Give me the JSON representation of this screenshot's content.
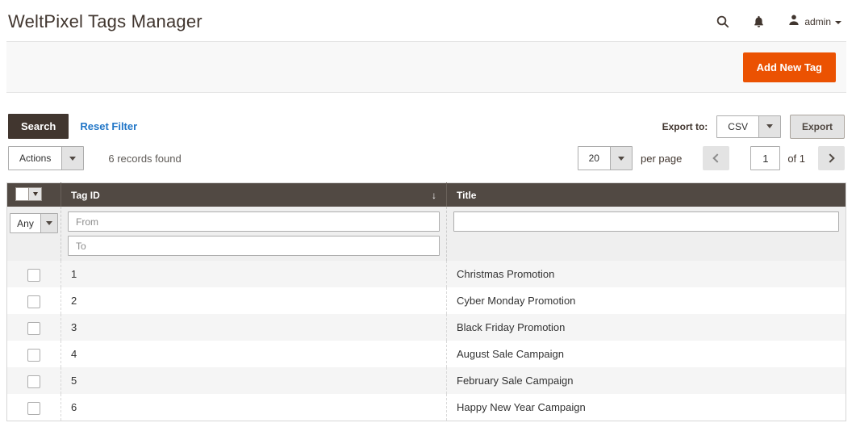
{
  "page": {
    "title": "WeltPixel Tags Manager"
  },
  "header": {
    "username": "admin"
  },
  "toolbar": {
    "add_new_tag": "Add New Tag"
  },
  "filter_bar": {
    "search": "Search",
    "reset_filter": "Reset Filter",
    "export_to_label": "Export to:",
    "export_format": "CSV",
    "export": "Export"
  },
  "grid_controls": {
    "actions": "Actions",
    "records_found": "6 records found",
    "per_page_value": "20",
    "per_page_label": "per page",
    "current_page": "1",
    "total_pages_label": "of 1"
  },
  "grid": {
    "mass_select_value": "Any",
    "columns": {
      "tag_id": "Tag ID",
      "title": "Title"
    },
    "sort": {
      "column": "Tag ID",
      "direction_glyph": "↓"
    },
    "filters": {
      "from_placeholder": "From",
      "to_placeholder": "To",
      "title_value": ""
    },
    "rows": [
      {
        "tag_id": "1",
        "title": "Christmas Promotion"
      },
      {
        "tag_id": "2",
        "title": "Cyber Monday Promotion"
      },
      {
        "tag_id": "3",
        "title": "Black Friday Promotion"
      },
      {
        "tag_id": "4",
        "title": "August Sale Campaign"
      },
      {
        "tag_id": "5",
        "title": "February Sale Campaign"
      },
      {
        "tag_id": "6",
        "title": "Happy New Year Campaign"
      }
    ]
  },
  "colors": {
    "accent": "#eb5202",
    "grid_header_bg": "#514943",
    "dark_button_bg": "#41362f",
    "link": "#2176c7",
    "stripe": "#f5f5f5",
    "band_bg": "#f8f8f8"
  }
}
